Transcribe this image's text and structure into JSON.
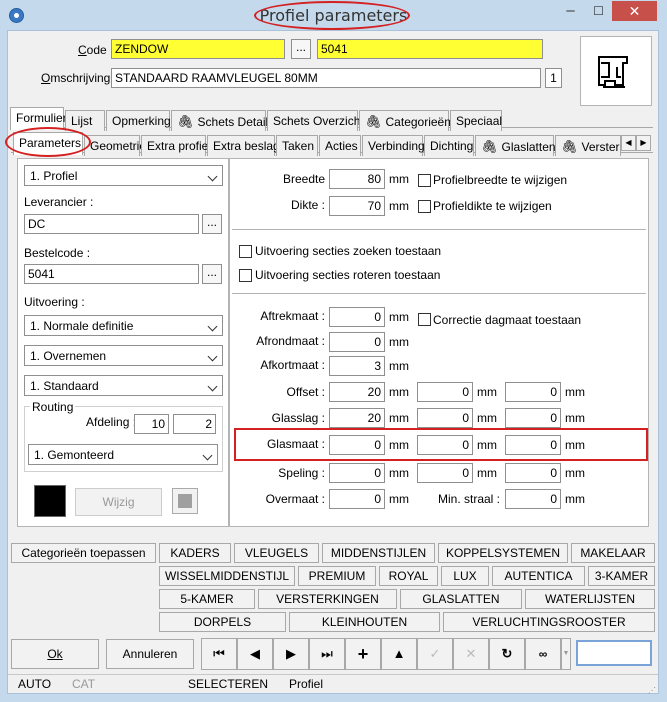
{
  "window": {
    "title": "Profiel parameters",
    "minimize": "–",
    "maximize": "☐",
    "close": "✕"
  },
  "header": {
    "code_label": "Code :",
    "code_value": "ZENDOW",
    "code_number": "5041",
    "omschrijving_label": "Omschrijving :",
    "omschrijving_value": "STANDAARD RAAMVLEUGEL 80MM",
    "omschrijving_count": "1",
    "dots": "..."
  },
  "main_tabs": [
    "Formulier",
    "Lijst",
    "Opmerking",
    "Schets Detail",
    "Schets Overzicht",
    "Categorieën",
    "Speciaal"
  ],
  "sub_tabs": [
    "Parameters",
    "Geometrie",
    "Extra profiel",
    "Extra beslag",
    "Taken",
    "Acties",
    "Verbinding",
    "Dichting",
    "Glaslatten",
    "Versterk"
  ],
  "left": {
    "type_select": "1. Profiel",
    "leverancier_label": "Leverancier :",
    "leverancier_value": "DC",
    "bestelcode_label": "Bestelcode :",
    "bestelcode_value": "5041",
    "uitvoering_label": "Uitvoering :",
    "uitvoering_1": "1. Normale definitie",
    "uitvoering_2": "1. Overnemen",
    "uitvoering_3": "1. Standaard",
    "routing_label": "Routing",
    "afdeling_label": "Afdeling :",
    "afdeling_1": "10",
    "afdeling_2": "2",
    "routing_select": "1. Gemonteerd",
    "wijzig": "Wijzig"
  },
  "right": {
    "breedte_label": "Breedte :",
    "breedte": "80",
    "dikte_label": "Dikte :",
    "dikte": "70",
    "unit": "mm",
    "cb_breedte": "Profielbreedte te wijzigen",
    "cb_dikte": "Profieldikte te wijzigen",
    "cb_zoeken": "Uitvoering secties zoeken toestaan",
    "cb_roteren": "Uitvoering secties roteren toestaan",
    "aftrekmaat_label": "Aftrekmaat :",
    "aftrekmaat": "0",
    "cb_correctie": "Correctie dagmaat toestaan",
    "afrondmaat_label": "Afrondmaat :",
    "afrondmaat": "0",
    "afkortmaat_label": "Afkortmaat :",
    "afkortmaat": "3",
    "offset_label": "Offset :",
    "offset": [
      "20",
      "0",
      "0"
    ],
    "glasslag_label": "Glasslag :",
    "glasslag": [
      "20",
      "0",
      "0"
    ],
    "glasmaat_label": "Glasmaat :",
    "glasmaat": [
      "0",
      "0",
      "0"
    ],
    "speling_label": "Speling :",
    "speling": [
      "0",
      "0",
      "0"
    ],
    "overmaat_label": "Overmaat :",
    "overmaat": "0",
    "minstraal_label": "Min. straal :",
    "minstraal": "0"
  },
  "categories": {
    "apply": "Categorieën toepassen",
    "row1": [
      "KADERS",
      "VLEUGELS",
      "MIDDENSTIJLEN",
      "KOPPELSYSTEMEN",
      "MAKELAAR"
    ],
    "row2": [
      "WISSELMIDDENSTIJL",
      "PREMIUM",
      "ROYAL",
      "LUX",
      "AUTENTICA",
      "3-KAMER"
    ],
    "row3": [
      "5-KAMER",
      "VERSTERKINGEN",
      "GLASLATTEN",
      "WATERLIJSTEN"
    ],
    "row4": [
      "DORPELS",
      "KLEINHOUTEN",
      "VERLUCHTINGSROOSTER"
    ]
  },
  "footer": {
    "ok": "Ok",
    "annuleren": "Annuleren"
  },
  "status": {
    "auto": "AUTO",
    "cat": "CAT",
    "mode": "SELECTEREN",
    "context": "Profiel"
  }
}
